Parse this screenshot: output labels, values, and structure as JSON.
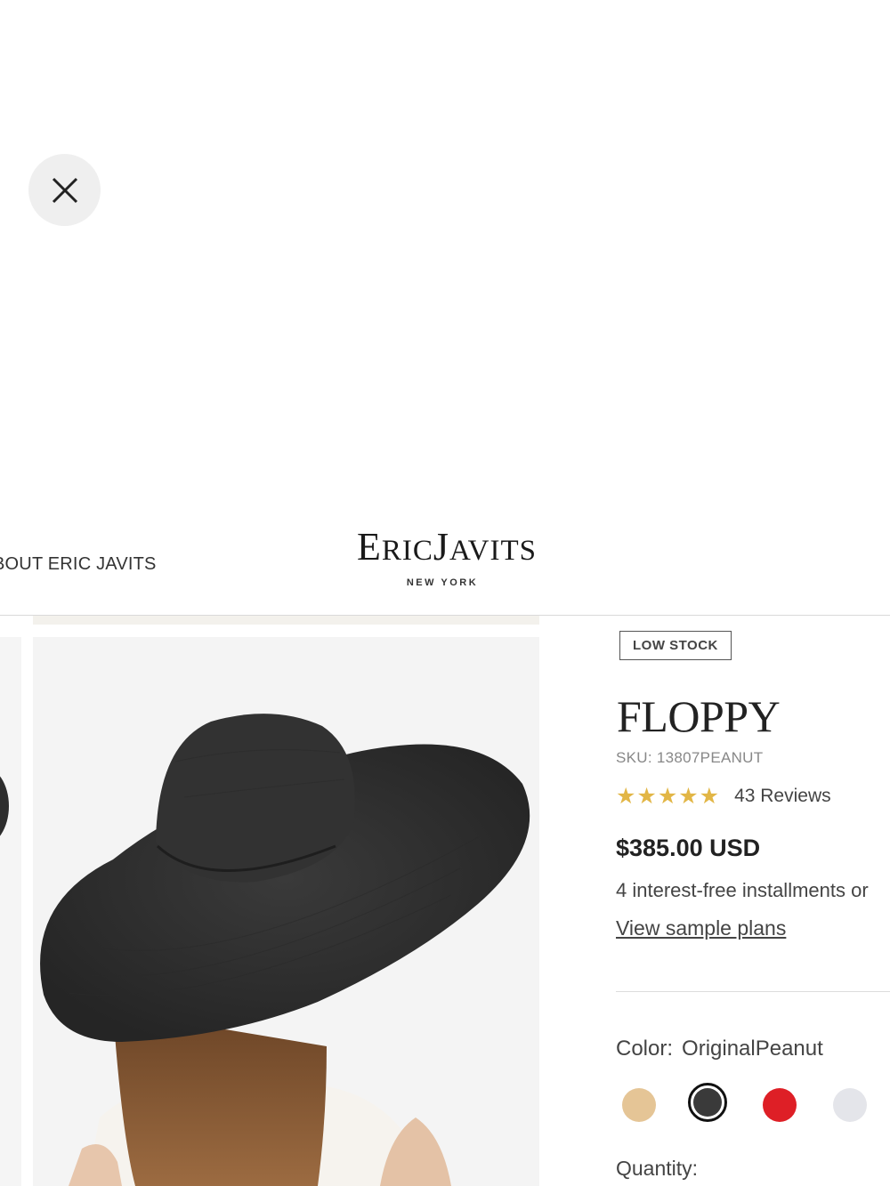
{
  "overlay": {
    "close_label": "close"
  },
  "header": {
    "nav_about": "BOUT ERIC JAVITS",
    "logo_text": "EricJavits",
    "logo_sub": "NEW YORK"
  },
  "product": {
    "badge": "LOW STOCK",
    "title": "FLOPPY",
    "sku": "SKU: 13807PEANUT",
    "stars": "★★★★★",
    "reviews": "43 Reviews",
    "price": "$385.00 USD",
    "installments": "4 interest-free installments or",
    "sample_plans": "View sample plans",
    "color_label": "Color:",
    "color_value": "OriginalPeanut",
    "swatches": [
      {
        "name": "peanut",
        "color": "#e5c596"
      },
      {
        "name": "black",
        "color": "#3a3a3a",
        "selected": true
      },
      {
        "name": "red",
        "color": "#de1f26"
      },
      {
        "name": "white",
        "color": "#e4e5ea"
      }
    ],
    "quantity_label": "Quantity:"
  },
  "colors": {
    "star": "#e2b646",
    "text": "#222222",
    "muted": "#888888"
  }
}
